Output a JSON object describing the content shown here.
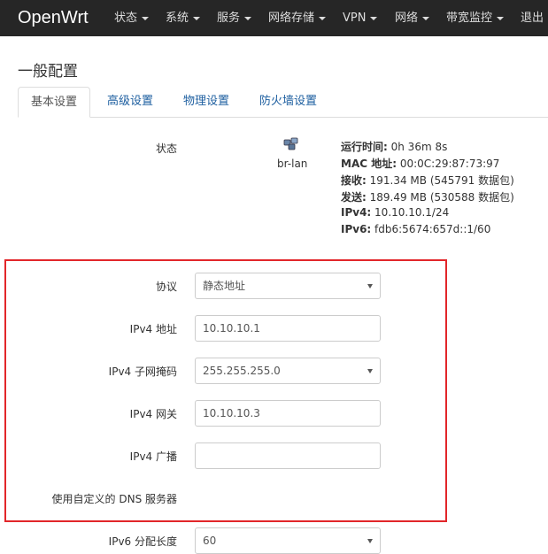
{
  "nav": {
    "brand": "OpenWrt",
    "items": [
      {
        "label": "状态",
        "caret": true
      },
      {
        "label": "系统",
        "caret": true
      },
      {
        "label": "服务",
        "caret": true
      },
      {
        "label": "网络存储",
        "caret": true
      },
      {
        "label": "VPN",
        "caret": true
      },
      {
        "label": "网络",
        "caret": true
      },
      {
        "label": "带宽监控",
        "caret": true
      },
      {
        "label": "退出",
        "caret": false
      }
    ]
  },
  "page_title": "一般配置",
  "tabs": [
    {
      "label": "基本设置"
    },
    {
      "label": "高级设置"
    },
    {
      "label": "物理设置"
    },
    {
      "label": "防火墙设置"
    }
  ],
  "status": {
    "label": "状态",
    "interface": "br-lan",
    "lines": [
      {
        "key": "运行时间:",
        "value": " 0h 36m 8s"
      },
      {
        "key": "MAC 地址:",
        "value": " 00:0C:29:87:73:97"
      },
      {
        "key": "接收:",
        "value": " 191.34 MB (545791 数据包)"
      },
      {
        "key": "发送:",
        "value": " 189.49 MB (530588 数据包)"
      },
      {
        "key": "IPv4:",
        "value": " 10.10.10.1/24"
      },
      {
        "key": "IPv6:",
        "value": " fdb6:5674:657d::1/60"
      }
    ]
  },
  "form": {
    "protocol": {
      "label": "协议",
      "value": "静态地址"
    },
    "ipv4_addr": {
      "label": "IPv4 地址",
      "value": "10.10.10.1"
    },
    "ipv4_mask": {
      "label": "IPv4 子网掩码",
      "value": "255.255.255.0"
    },
    "ipv4_gw": {
      "label": "IPv4 网关",
      "value": "10.10.10.3"
    },
    "ipv4_bcast": {
      "label": "IPv4 广播",
      "value": ""
    },
    "custom_dns": {
      "label": "使用自定义的 DNS 服务器"
    },
    "ipv6_len": {
      "label": "IPv6 分配长度",
      "value": "60"
    }
  },
  "colors": {
    "navbar": "#262626",
    "link": "#1e5fa0",
    "highlight_box": "#e2262a"
  }
}
